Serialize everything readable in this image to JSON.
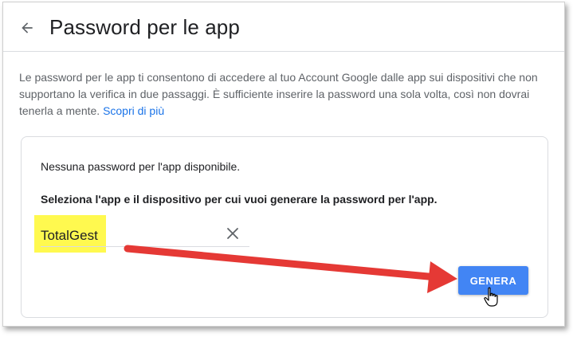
{
  "header": {
    "title": "Password per le app",
    "back_icon": "arrow-back-icon"
  },
  "description": {
    "text": "Le password per le app ti consentono di accedere al tuo Account Google dalle app sui dispositivi che non supportano la verifica in due passaggi. È sufficiente inserire la password una sola volta, così non dovrai tenerla a mente.",
    "link_label": "Scopri di più",
    "link_color": "#1a73e8"
  },
  "card": {
    "empty_message": "Nessuna password per l'app disponibile.",
    "instruction": "Seleziona l'app e il dispositivo per cui vuoi generare la password per l'app.",
    "app_field_value": "TotalGest",
    "clear_icon": "close-icon",
    "generate_button_label": "GENERA",
    "generate_button_color": "#4285f4"
  },
  "annotations": {
    "highlight_color": "#fff94f",
    "arrow_color": "#e53935",
    "pointer_icon": "hand-pointer-icon"
  }
}
